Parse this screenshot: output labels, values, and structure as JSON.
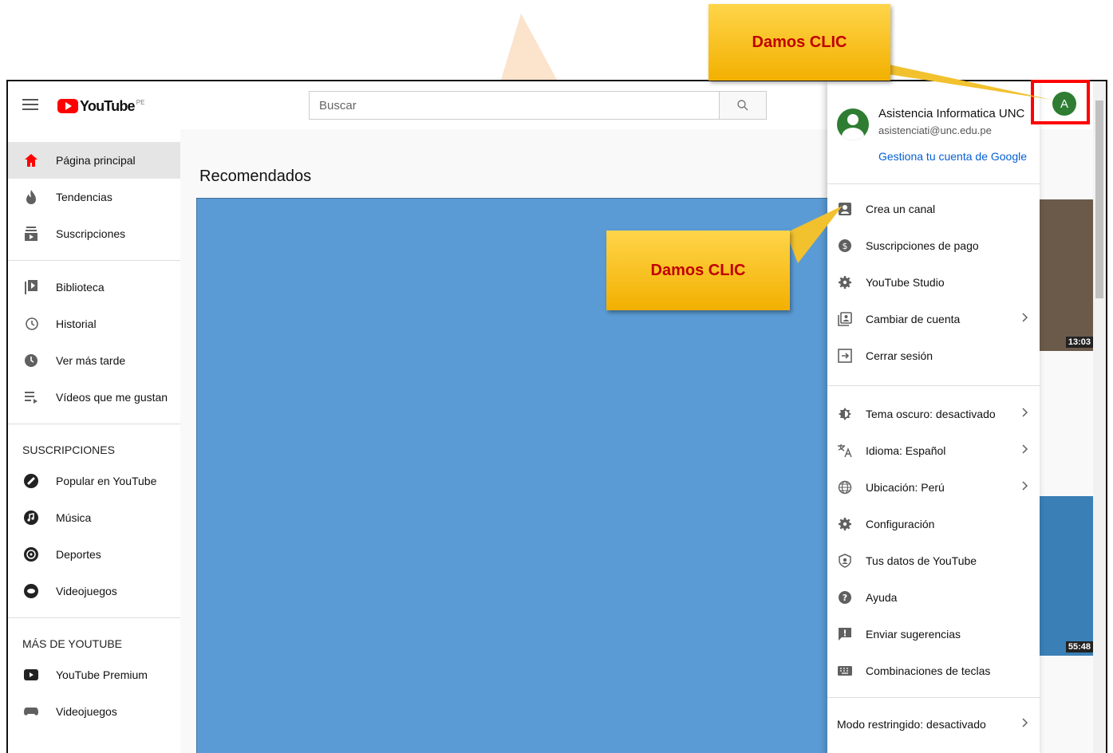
{
  "logo": {
    "text": "YouTube",
    "country": "PE"
  },
  "search": {
    "placeholder": "Buscar"
  },
  "sidebar": {
    "main": [
      {
        "label": "Página principal",
        "icon": "home-icon",
        "active": true
      },
      {
        "label": "Tendencias",
        "icon": "flame-icon"
      },
      {
        "label": "Suscripciones",
        "icon": "subscriptions-icon"
      }
    ],
    "library": [
      {
        "label": "Biblioteca",
        "icon": "library-icon"
      },
      {
        "label": "Historial",
        "icon": "history-icon"
      },
      {
        "label": "Ver más tarde",
        "icon": "clock-icon"
      },
      {
        "label": "Vídeos que me gustan",
        "icon": "playlist-icon"
      }
    ],
    "subscriptions_heading": "SUSCRIPCIONES",
    "subscriptions": [
      {
        "label": "Popular en YouTube",
        "icon": "popular-channel-icon"
      },
      {
        "label": "Música",
        "icon": "music-channel-icon"
      },
      {
        "label": "Deportes",
        "icon": "sports-channel-icon"
      },
      {
        "label": "Videojuegos",
        "icon": "gaming-channel-icon"
      }
    ],
    "more_heading": "MÁS DE YOUTUBE",
    "more": [
      {
        "label": "YouTube Premium",
        "icon": "youtube-premium-icon"
      },
      {
        "label": "Videojuegos",
        "icon": "gaming-icon"
      }
    ]
  },
  "main": {
    "section_title": "Recomendados"
  },
  "side_videos": [
    {
      "duration": "13:03"
    },
    {
      "duration": "55:48"
    }
  ],
  "account_menu": {
    "name": "Asistencia Informatica UNC",
    "email": "asistenciati@unc.edu.pe",
    "manage": "Gestiona tu cuenta de Google",
    "group1": [
      {
        "label": "Crea un canal",
        "icon": "create-channel-icon"
      },
      {
        "label": "Suscripciones de pago",
        "icon": "paid-subscriptions-icon"
      },
      {
        "label": "YouTube Studio",
        "icon": "studio-gear-icon"
      },
      {
        "label": "Cambiar de cuenta",
        "icon": "switch-account-icon",
        "chevron": true
      },
      {
        "label": "Cerrar sesión",
        "icon": "sign-out-icon"
      }
    ],
    "group2": [
      {
        "label": "Tema oscuro: desactivado",
        "icon": "dark-theme-icon",
        "chevron": true
      },
      {
        "label": "Idioma: Español",
        "icon": "language-icon",
        "chevron": true
      },
      {
        "label": "Ubicación: Perú",
        "icon": "globe-icon",
        "chevron": true
      },
      {
        "label": "Configuración",
        "icon": "settings-icon"
      },
      {
        "label": "Tus datos de YouTube",
        "icon": "your-data-icon"
      },
      {
        "label": "Ayuda",
        "icon": "help-icon"
      },
      {
        "label": "Enviar sugerencias",
        "icon": "feedback-icon"
      },
      {
        "label": "Combinaciones de teclas",
        "icon": "keyboard-icon"
      }
    ],
    "restricted": "Modo restringido: desactivado"
  },
  "user_avatar_letter": "A",
  "callouts": {
    "top": "Damos CLIC",
    "middle": "Damos CLIC"
  },
  "colors": {
    "youtube_red": "#ff0000",
    "link_blue": "#065fd4",
    "callout_yellow": "#f2b000",
    "callout_text": "#c00000",
    "avatar_green": "#2e7d32",
    "thumbnail_blue": "#5b9bd5"
  }
}
